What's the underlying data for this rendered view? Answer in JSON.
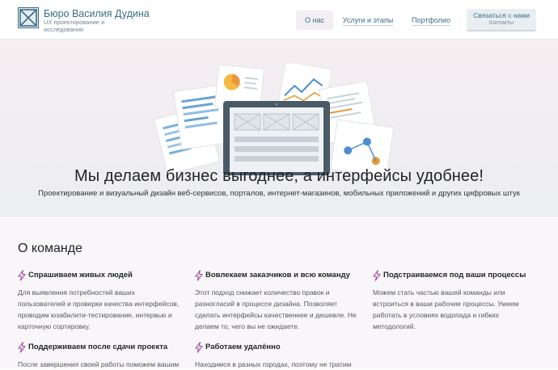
{
  "header": {
    "brand_name": "Бюро Василия Дудина",
    "brand_tagline": "UX проектирование и исследования",
    "nav": {
      "about": "О нас",
      "services": "Услуги и этапы",
      "portfolio": "Портфолио"
    },
    "contact": {
      "main": "Связаться с нами",
      "sub": "Контакты"
    }
  },
  "hero": {
    "title": "Мы делаем бизнес выгоднее, а интерфейсы удобнее!",
    "subtitle": "Проектирование и визуальный дизайн веб-сервисов, порталов, интернет-магазинов, мобильных приложений и других цифровых штук"
  },
  "about": {
    "title": "О команде",
    "features": [
      {
        "title": "Спрашиваем живых людей",
        "text": "Для выявления потребностей ваших пользователей и проверки качества интерфейсов, проводим юзабилити-тестирование, интервью и карточную сортировку."
      },
      {
        "title": "Вовлекаем заказчиков и всю команду",
        "text": "Этот подход снижает количество правок и разногласий в процессе дизайна. Позволяет сделать интерфейсы качественнее и дешевле. Не делаем то, чего вы не ожидаете."
      },
      {
        "title": "Подстраиваемся под ваши процессы",
        "text": "Можем стать частью вашей команды или встроиться в ваши рабочие процессы. Умеем работать в условиях водопада и гибких методологий."
      },
      {
        "title": "Поддерживаем после сдачи проекта",
        "text": "После завершения своей работы поможем вашим"
      },
      {
        "title": "Работаем удалённо",
        "text": "Находимся в разных городах, поэтому не тратим"
      }
    ]
  },
  "colors": {
    "brand": "#3b6d86",
    "accent_bolt": "#a0469a",
    "laptop": "#4a5a66"
  },
  "icons": {
    "logo": "logo-mark-icon",
    "feature": "lightning-bolt-icon"
  }
}
